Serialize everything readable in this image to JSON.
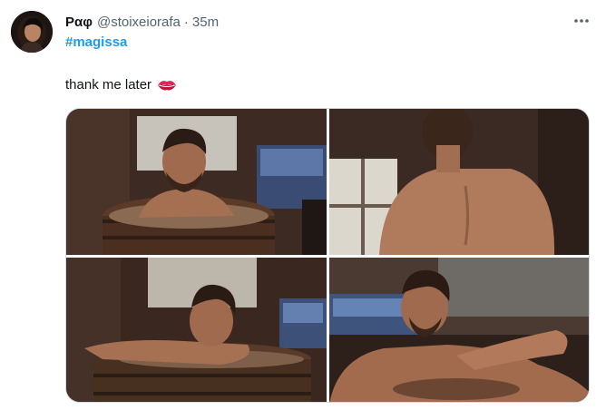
{
  "tweet": {
    "author_name": "Ραφ",
    "author_handle": "@stoixeiorafa",
    "separator": "·",
    "time": "35m",
    "hashtag": "#magissa",
    "text": "thank me later",
    "text_emoji_icon": "kiss-mark-icon",
    "more_icon": "more-horizontal-icon"
  },
  "colors": {
    "link": "#1d9bf0",
    "secondary_text": "#536471",
    "primary_text": "#0f1419",
    "border": "#cfd9de"
  }
}
